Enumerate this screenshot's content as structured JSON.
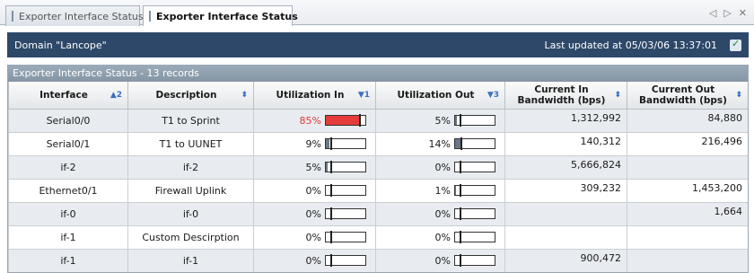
{
  "tabs": [
    {
      "label": "Exporter Interface Status",
      "active": false
    },
    {
      "label": "Exporter Interface Status",
      "active": true
    }
  ],
  "tab_nav": {
    "prev": "◁",
    "next": "▷",
    "close": "✕"
  },
  "domain": {
    "label": "Domain \"Lancope\"",
    "updated": "Last updated at 05/03/06 13:37:01",
    "refresh_icon": "refresh-icon"
  },
  "panel": {
    "title": "Exporter Interface Status - 13 records"
  },
  "columns": [
    {
      "label": "Interface",
      "sort": "▲2"
    },
    {
      "label": "Description",
      "sort": "⬍"
    },
    {
      "label": "Utilization In",
      "sort": "▼1"
    },
    {
      "label": "Utilization Out",
      "sort": "▼3"
    },
    {
      "label": "Current In Bandwidth (bps)",
      "sort": "⬍"
    },
    {
      "label": "Current Out Bandwidth (bps)",
      "sort": "⬍"
    }
  ],
  "rows": [
    {
      "interface": "Serial0/0",
      "description": "T1 to Sprint",
      "util_in": "85%",
      "util_in_val": 0.85,
      "util_in_hot": true,
      "util_out": "5%",
      "util_out_val": 0.05,
      "bw_in": "1,312,992",
      "bw_out": "84,880"
    },
    {
      "interface": "Serial0/1",
      "description": "T1 to UUNET",
      "util_in": "9%",
      "util_in_val": 0.09,
      "util_in_hot": false,
      "util_out": "14%",
      "util_out_val": 0.14,
      "bw_in": "140,312",
      "bw_out": "216,496"
    },
    {
      "interface": "if-2",
      "description": "if-2",
      "util_in": "5%",
      "util_in_val": 0.05,
      "util_in_hot": false,
      "util_out": "0%",
      "util_out_val": 0.0,
      "bw_in": "5,666,824",
      "bw_out": ""
    },
    {
      "interface": "Ethernet0/1",
      "description": "Firewall Uplink",
      "util_in": "0%",
      "util_in_val": 0.0,
      "util_in_hot": false,
      "util_out": "1%",
      "util_out_val": 0.01,
      "bw_in": "309,232",
      "bw_out": "1,453,200"
    },
    {
      "interface": "if-0",
      "description": "if-0",
      "util_in": "0%",
      "util_in_val": 0.0,
      "util_in_hot": false,
      "util_out": "0%",
      "util_out_val": 0.0,
      "bw_in": "",
      "bw_out": "1,664"
    },
    {
      "interface": "if-1",
      "description": "Custom Descirption",
      "util_in": "0%",
      "util_in_val": 0.0,
      "util_in_hot": false,
      "util_out": "0%",
      "util_out_val": 0.0,
      "bw_in": "",
      "bw_out": ""
    },
    {
      "interface": "if-1",
      "description": "if-1",
      "util_in": "0%",
      "util_in_val": 0.0,
      "util_in_hot": false,
      "util_out": "0%",
      "util_out_val": 0.0,
      "bw_in": "900,472",
      "bw_out": ""
    }
  ],
  "colors": {
    "header_bar": "#2d4869",
    "panel_title": "#8e9fae",
    "hot": "#e63b3b",
    "bar_fill": "#6a7886"
  }
}
